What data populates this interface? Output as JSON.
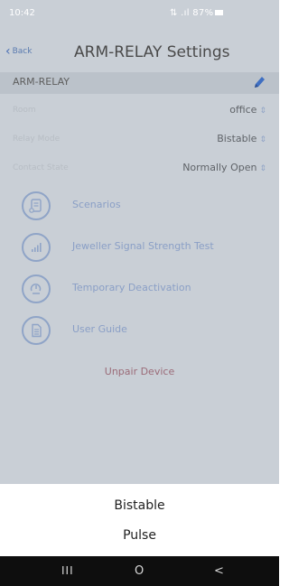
{
  "status_bar": {
    "time": "10:42",
    "indicators": "⇅ .ıl 87%"
  },
  "header": {
    "back_label": "Back",
    "title": "ARM-RELAY Settings"
  },
  "device": {
    "name": "ARM-RELAY"
  },
  "settings": [
    {
      "label": "Room",
      "value": "office"
    },
    {
      "label": "Relay Mode",
      "value": "Bistable"
    },
    {
      "label": "Contact State",
      "value": "Normally Open"
    }
  ],
  "menu": [
    {
      "label": "Scenarios",
      "icon": "scenarios-icon"
    },
    {
      "label": "Jeweller Signal Strength Test",
      "icon": "signal-strength-icon"
    },
    {
      "label": "Temporary Deactivation",
      "icon": "deactivation-icon"
    },
    {
      "label": "User Guide",
      "icon": "user-guide-icon"
    }
  ],
  "unpair_label": "Unpair Device",
  "picker": {
    "options": [
      "Bistable",
      "Pulse"
    ]
  },
  "navbar": {
    "recents": "III",
    "home": "O",
    "back": "<"
  },
  "colors": {
    "overlay": "#c9cfd6",
    "accent": "#8fa4c7",
    "danger": "#9b6b78",
    "sheet": "#ffffff",
    "navbar": "#0e0e0e"
  }
}
